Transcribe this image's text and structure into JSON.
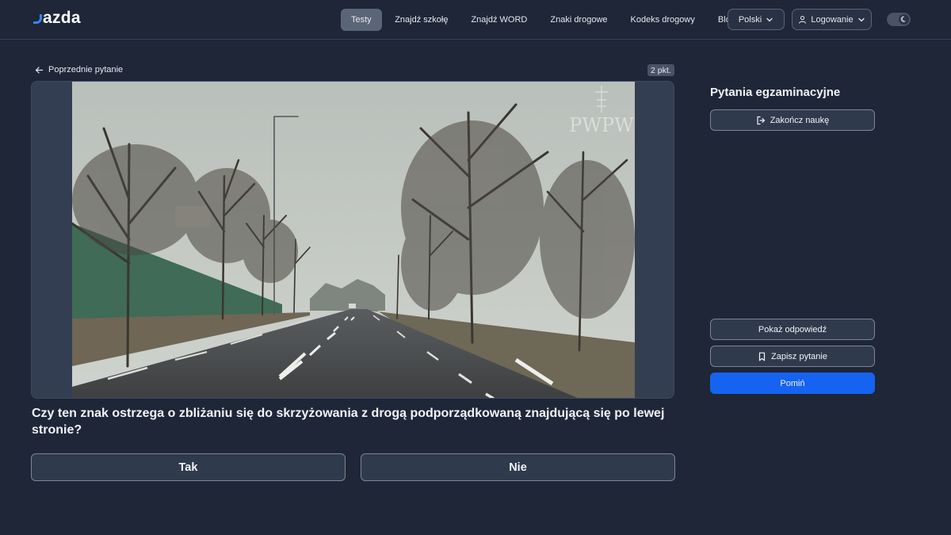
{
  "brand": {
    "name": "azda"
  },
  "nav": {
    "items": [
      {
        "label": "Testy",
        "active": true
      },
      {
        "label": "Znajdź szkołę"
      },
      {
        "label": "Znajdź WORD"
      },
      {
        "label": "Znaki drogowe"
      },
      {
        "label": "Kodeks drogowy"
      },
      {
        "label": "Blog"
      }
    ],
    "language": "Polski",
    "login": "Logowanie"
  },
  "question": {
    "back_label": "Poprzednie pytanie",
    "points": "2 pkt.",
    "watermark": "PWPW",
    "text": "Czy ten znak ostrzega o zbliżaniu się do skrzyżowania z drogą podporządkowaną znajdującą się po lewej stronie?",
    "answers": [
      "Tak",
      "Nie"
    ]
  },
  "sidebar": {
    "title": "Pytania egzaminacyjne",
    "finish_label": "Zakończ naukę",
    "show_answer_label": "Pokaż odpowiedź",
    "save_label": "Zapisz pytanie",
    "skip_label": "Pomiń"
  },
  "colors": {
    "background": "#1e2637",
    "primary": "#1663f2",
    "accent": "#3b82f6"
  }
}
